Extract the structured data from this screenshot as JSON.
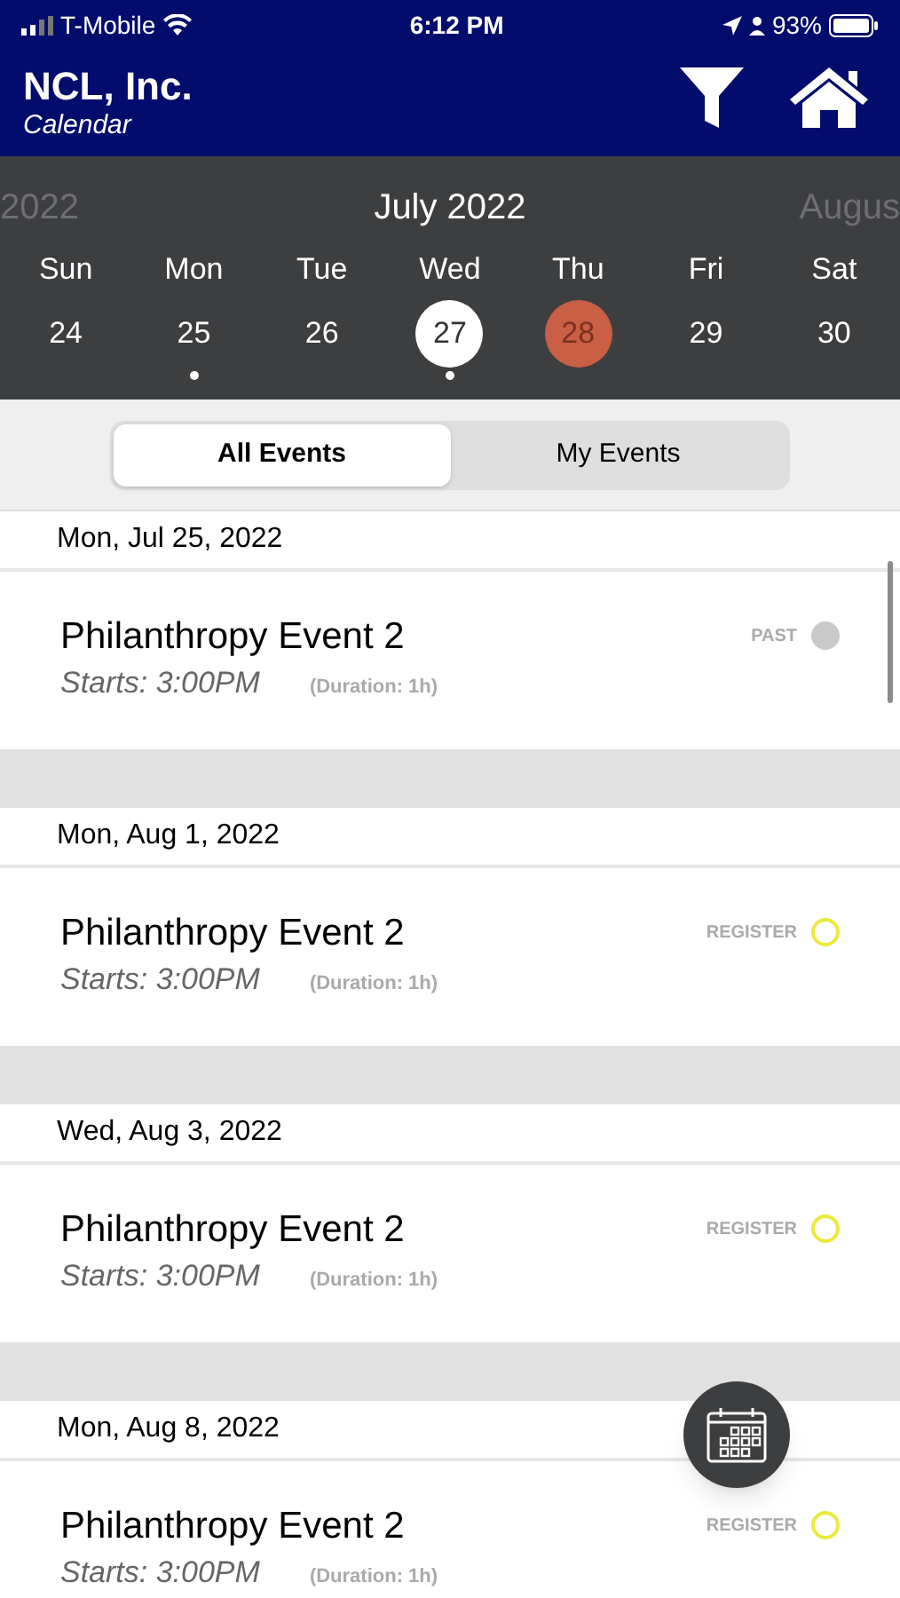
{
  "status_bar": {
    "carrier": "T-Mobile",
    "time": "6:12 PM",
    "battery": "93%"
  },
  "header": {
    "title": "NCL, Inc.",
    "subtitle": "Calendar"
  },
  "calendar": {
    "prev_month": "2022",
    "month": "July 2022",
    "next_month": "Augus",
    "days": [
      {
        "weekday": "Sun",
        "date": "24",
        "selected": false,
        "today": false,
        "has_events": false
      },
      {
        "weekday": "Mon",
        "date": "25",
        "selected": false,
        "today": false,
        "has_events": true
      },
      {
        "weekday": "Tue",
        "date": "26",
        "selected": false,
        "today": false,
        "has_events": false
      },
      {
        "weekday": "Wed",
        "date": "27",
        "selected": true,
        "today": false,
        "has_events": true
      },
      {
        "weekday": "Thu",
        "date": "28",
        "selected": false,
        "today": true,
        "has_events": false
      },
      {
        "weekday": "Fri",
        "date": "29",
        "selected": false,
        "today": false,
        "has_events": false
      },
      {
        "weekday": "Sat",
        "date": "30",
        "selected": false,
        "today": false,
        "has_events": false
      }
    ]
  },
  "tabs": [
    {
      "label": "All Events",
      "selected": true
    },
    {
      "label": "My Events",
      "selected": false
    }
  ],
  "sections": [
    {
      "date": "Mon, Jul 25, 2022",
      "events": [
        {
          "title": "Philanthropy Event 2",
          "starts": "Starts: 3:00PM",
          "duration": "(Duration: 1h)",
          "status": "PAST",
          "kind": "past"
        }
      ]
    },
    {
      "date": "Mon, Aug 1, 2022",
      "events": [
        {
          "title": "Philanthropy Event 2",
          "starts": "Starts: 3:00PM",
          "duration": "(Duration: 1h)",
          "status": "REGISTER",
          "kind": "register"
        }
      ]
    },
    {
      "date": "Wed, Aug 3, 2022",
      "events": [
        {
          "title": "Philanthropy Event 2",
          "starts": "Starts: 3:00PM",
          "duration": "(Duration: 1h)",
          "status": "REGISTER",
          "kind": "register"
        }
      ]
    },
    {
      "date": "Mon, Aug 8, 2022",
      "events": [
        {
          "title": "Philanthropy Event 2",
          "starts": "Starts: 3:00PM",
          "duration": "(Duration: 1h)",
          "status": "REGISTER",
          "kind": "register"
        }
      ]
    }
  ]
}
